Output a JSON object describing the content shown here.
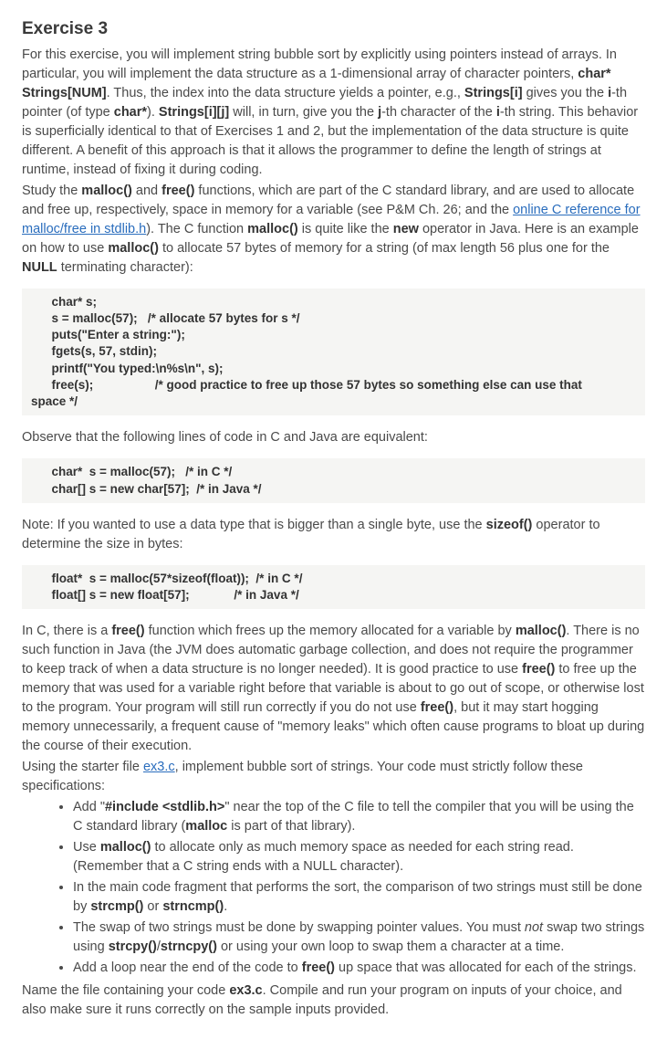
{
  "title": "Exercise 3",
  "p1a": "For this exercise, you will implement string bubble sort by explicitly using pointers instead of arrays. In particular, you will implement the data structure as a 1-dimensional array of character pointers, ",
  "p1b": "char* Strings[NUM]",
  "p1c": ". Thus, the index into the data structure yields a pointer, e.g., ",
  "p1d": "Strings[i]",
  "p1e": " gives you the ",
  "p1f": "i",
  "p1g": "-th pointer (of type ",
  "p1h": "char*",
  "p1i": "). ",
  "p1j": "Strings[i][j]",
  "p1k": " will, in turn, give you the ",
  "p1l": "j",
  "p1m": "-th character of the ",
  "p1n": "i",
  "p1o": "-th string. This behavior is superficially identical to that of Exercises 1 and 2, but the implementation of the data structure is quite different. A benefit of this approach is that it allows the programmer to define the length of strings at runtime, instead of fixing it during coding.",
  "p2a": "Study the ",
  "p2b": "malloc()",
  "p2c": " and ",
  "p2d": "free()",
  "p2e": " functions, which are part of the C standard library, and are used to allocate and free up, respectively, space in memory for a variable (see P&M Ch. 26; and the ",
  "p2f": "online C reference for malloc/free in stdlib.h",
  "p2g": "). The C function ",
  "p2h": "malloc()",
  "p2i": " is quite like the ",
  "p2j": "new",
  "p2k": " operator in Java. Here is an example on how to use ",
  "p2l": "malloc()",
  "p2m": " to allocate 57 bytes of memory for a string (of max length 56 plus one for the ",
  "p2n": "NULL",
  "p2o": " terminating character):",
  "code1": "      char* s;\n      s = malloc(57);   /* allocate 57 bytes for s */\n      puts(\"Enter a string:\");\n      fgets(s, 57, stdin);\n      printf(\"You typed:\\n%s\\n\", s);\n      free(s);                  /* good practice to free up those 57 bytes so something else can use that\nspace */",
  "p3": "Observe that the following lines of code in C and Java are equivalent:",
  "code2": "      char*  s = malloc(57);   /* in C */\n      char[] s = new char[57];  /* in Java */",
  "p4a": "Note: If you wanted to use a data type that is bigger than a single byte, use the ",
  "p4b": "sizeof()",
  "p4c": " operator to determine the size in bytes:",
  "code3": "      float*  s = malloc(57*sizeof(float));  /* in C */\n      float[] s = new float[57];             /* in Java */",
  "p5a": "In C, there is a ",
  "p5b": "free()",
  "p5c": " function which frees up the memory allocated for a variable by ",
  "p5d": "malloc()",
  "p5e": ". There is no such function in Java (the JVM does automatic garbage collection, and does not require the programmer to keep track of when a data structure is no longer needed). It is good practice to use ",
  "p5f": "free()",
  "p5g": " to free up the memory that was used for a variable right before that variable is about to go out of scope, or otherwise lost to the program. Your program will still run correctly if you do not use ",
  "p5h": "free()",
  "p5i": ", but it may start hogging memory unnecessarily, a frequent cause of \"memory leaks\" which often cause programs to bloat up during the course of their execution.",
  "p6a": "Using the starter file ",
  "p6b": "ex3.c",
  "p6c": ", implement bubble sort of strings. Your code must strictly follow these specifications:",
  "li1a": "Add \"",
  "li1b": "#include <stdlib.h>",
  "li1c": "\" near the top of the C file to tell the compiler that you will be using the C standard library (",
  "li1d": "malloc",
  "li1e": " is part of that library).",
  "li2a": "Use ",
  "li2b": "malloc()",
  "li2c": " to allocate only as much memory space as needed for each string read. (Remember that a C string ends with a NULL character).",
  "li3a": "In the main code fragment that performs the sort, the comparison of two strings must still be done by ",
  "li3b": "strcmp()",
  "li3c": " or ",
  "li3d": "strncmp()",
  "li3e": ".",
  "li4a": "The swap of two strings must be done by swapping pointer values. You must ",
  "li4b": "not",
  "li4c": " swap two strings using ",
  "li4d": "strcpy()",
  "li4e": "/",
  "li4f": "strncpy()",
  "li4g": " or using your own loop to swap them a character at a time.",
  "li5a": "Add a loop near the end of the code to ",
  "li5b": "free()",
  "li5c": " up space that was allocated for each of the strings.",
  "p7a": "Name the file containing your code ",
  "p7b": "ex3.c",
  "p7c": ". Compile and run your program on inputs of your choice, and also make sure it runs correctly on the sample inputs provided."
}
